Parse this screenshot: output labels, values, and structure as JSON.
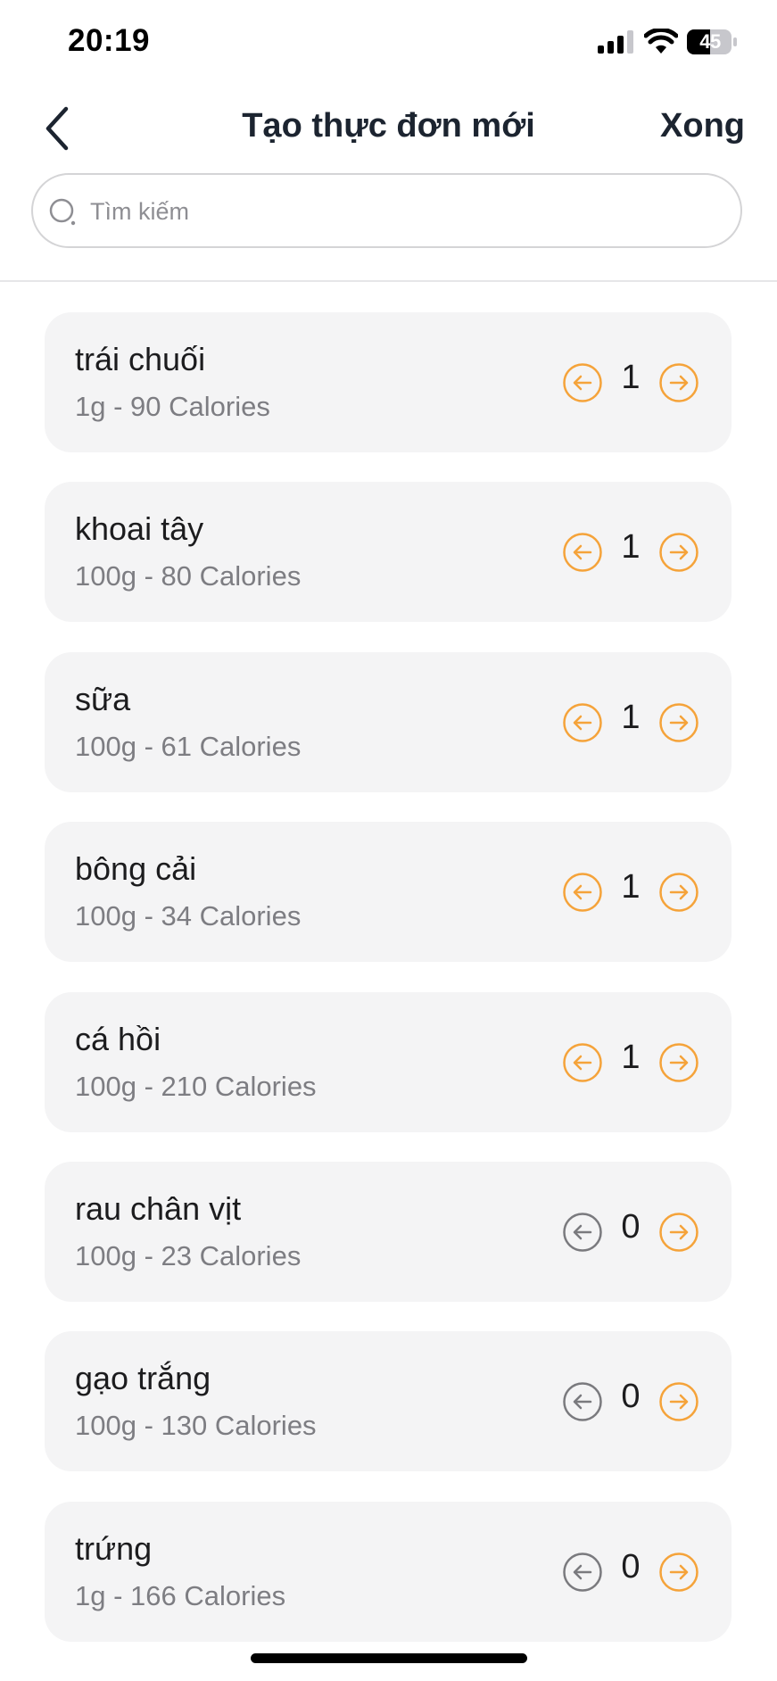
{
  "status_bar": {
    "time": "20:19",
    "battery_level": "45",
    "icons": [
      "signal-icon",
      "wifi-icon",
      "battery-icon"
    ]
  },
  "header": {
    "back_icon": "chevron-left-icon",
    "title": "Tạo thực đơn mới",
    "done_label": "Xong"
  },
  "search": {
    "placeholder": "Tìm kiếm",
    "value": "",
    "icon": "search-icon"
  },
  "colors": {
    "accent": "#F5A33A",
    "disabled": "#7A7A7E",
    "card_bg": "#F4F4F5"
  },
  "food_items": [
    {
      "name": "trái chuối",
      "detail": "1g - 90 Calories",
      "quantity": "1"
    },
    {
      "name": "khoai tây",
      "detail": "100g - 80 Calories",
      "quantity": "1"
    },
    {
      "name": "sữa",
      "detail": "100g - 61 Calories",
      "quantity": "1"
    },
    {
      "name": "bông cải",
      "detail": "100g - 34 Calories",
      "quantity": "1"
    },
    {
      "name": "cá hồi",
      "detail": "100g - 210 Calories",
      "quantity": "1"
    },
    {
      "name": "rau chân vịt",
      "detail": "100g - 23 Calories",
      "quantity": "0"
    },
    {
      "name": "gạo trắng",
      "detail": "100g - 130 Calories",
      "quantity": "0"
    },
    {
      "name": "trứng",
      "detail": "1g - 166 Calories",
      "quantity": "0"
    }
  ]
}
